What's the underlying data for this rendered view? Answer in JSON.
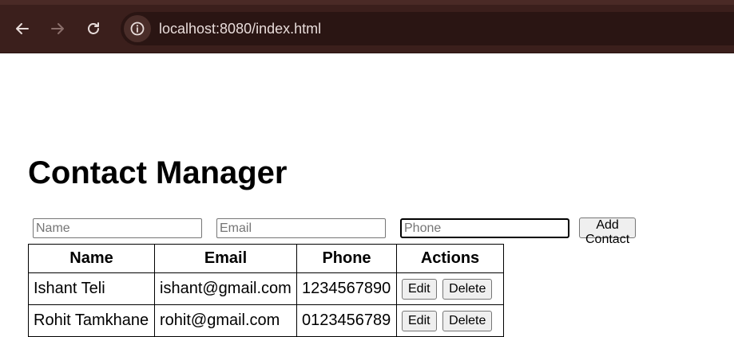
{
  "browser": {
    "url": "localhost:8080/index.html",
    "back_icon": "back-arrow-icon",
    "forward_icon": "forward-arrow-icon",
    "reload_icon": "reload-icon",
    "info_icon": "info-icon"
  },
  "page": {
    "title": "Contact Manager"
  },
  "form": {
    "name_placeholder": "Name",
    "email_placeholder": "Email",
    "phone_placeholder": "Phone",
    "add_label": "Add Contact"
  },
  "table": {
    "headers": [
      "Name",
      "Email",
      "Phone",
      "Actions"
    ],
    "rows": [
      {
        "name": "Ishant Teli",
        "email": "ishant@gmail.com",
        "phone": "1234567890",
        "edit": "Edit",
        "delete": "Delete"
      },
      {
        "name": "Rohit Tamkhane",
        "email": "rohit@gmail.com",
        "phone": "0123456789",
        "edit": "Edit",
        "delete": "Delete"
      }
    ]
  }
}
